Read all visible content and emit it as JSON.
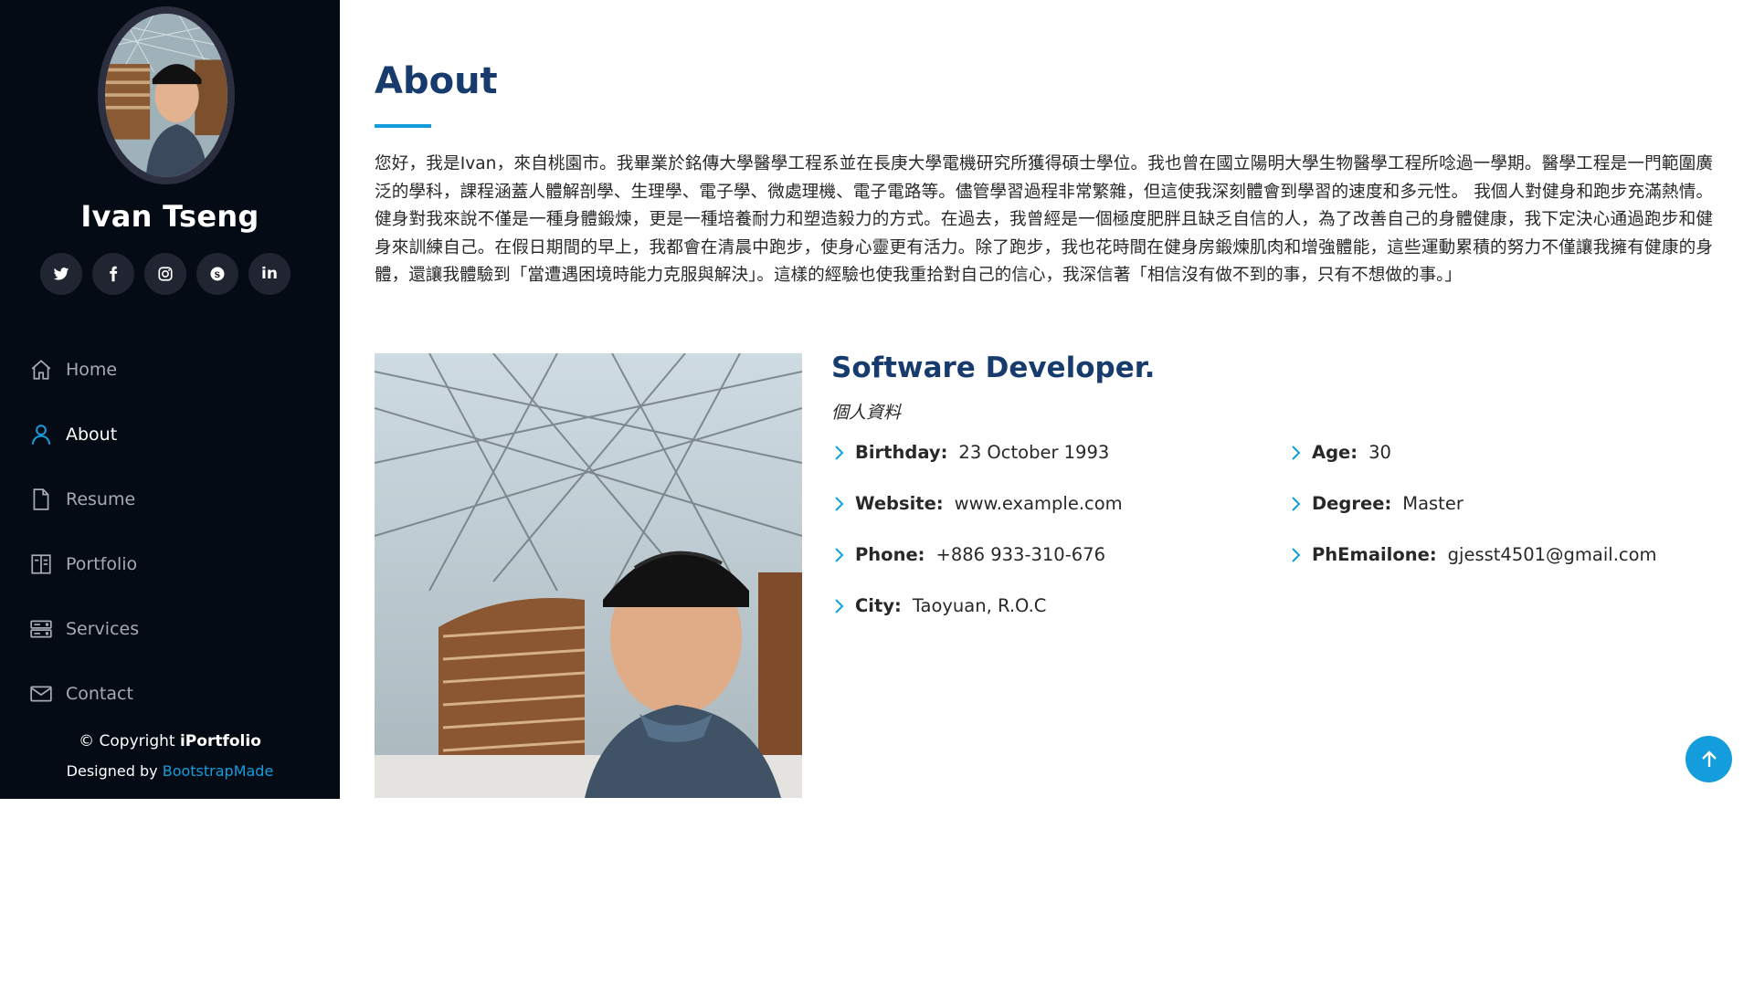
{
  "sidebar": {
    "profile_name": "Ivan Tseng",
    "social": [
      {
        "name": "twitter",
        "icon": "twitter-icon"
      },
      {
        "name": "facebook",
        "icon": "facebook-icon"
      },
      {
        "name": "instagram",
        "icon": "instagram-icon"
      },
      {
        "name": "skype",
        "icon": "skype-icon"
      },
      {
        "name": "linkedin",
        "icon": "linkedin-icon",
        "glyph": "in"
      }
    ],
    "nav": [
      {
        "label": "Home",
        "icon": "home-icon"
      },
      {
        "label": "About",
        "icon": "person-icon",
        "active": true
      },
      {
        "label": "Resume",
        "icon": "file-icon"
      },
      {
        "label": "Portfolio",
        "icon": "book-icon"
      },
      {
        "label": "Services",
        "icon": "server-icon"
      },
      {
        "label": "Contact",
        "icon": "envelope-icon"
      }
    ],
    "copyright_prefix": "© Copyright ",
    "copyright_brand": "iPortfolio",
    "credits_prefix": "Designed by ",
    "credits_link": "BootstrapMade"
  },
  "about": {
    "title": "About",
    "intro": "您好，我是Ivan，來自桃園市。我畢業於銘傳大學醫學工程系並在長庚大學電機研究所獲得碩士學位。我也曾在國立陽明大學生物醫學工程所唸過一學期。醫學工程是一門範圍廣泛的學科，課程涵蓋人體解剖學、生理學、電子學、微處理機、電子電路等。儘管學習過程非常繁雜，但這使我深刻體會到學習的速度和多元性。 我個人對健身和跑步充滿熱情。健身對我來說不僅是一種身體鍛煉，更是一種培養耐力和塑造毅力的方式。在過去，我曾經是一個極度肥胖且缺乏自信的人，為了改善自己的身體健康，我下定決心通過跑步和健身來訓練自己。在假日期間的早上，我都會在清晨中跑步，使身心靈更有活力。除了跑步，我也花時間在健身房鍛煉肌肉和增強體能，這些運動累積的努力不僅讓我擁有健康的身體，還讓我體驗到「當遭遇困境時能力克服與解決」。這樣的經驗也使我重拾對自己的信心，我深信著「相信沒有做不到的事，只有不想做的事。」",
    "role_title": "Software Developer.",
    "role_subtitle": "個人資料",
    "facts_left": [
      {
        "label": "Birthday:",
        "value": "23 October 1993"
      },
      {
        "label": "Website:",
        "value": "www.example.com"
      },
      {
        "label": "Phone:",
        "value": "+886 933-310-676"
      },
      {
        "label": "City:",
        "value": "Taoyuan, R.O.C"
      }
    ],
    "facts_right": [
      {
        "label": "Age:",
        "value": "30"
      },
      {
        "label": "Degree:",
        "value": "Master"
      },
      {
        "label": "PhEmailone:",
        "value": "gjesst4501@gmail.com"
      }
    ]
  },
  "colors": {
    "sidebar_bg": "#040b14",
    "accent": "#149ddd",
    "heading": "#173b6c",
    "text": "#272829"
  }
}
